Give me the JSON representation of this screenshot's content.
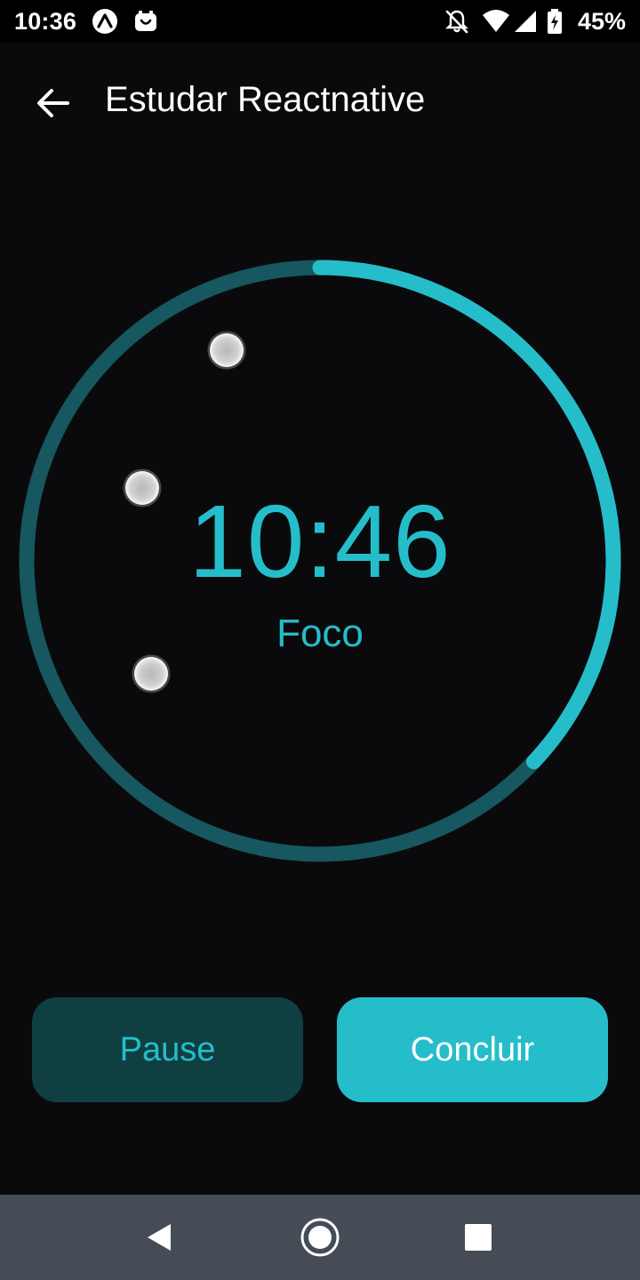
{
  "status_bar": {
    "time": "10:36",
    "icons": [
      "expo-icon",
      "app-notification-icon",
      "bell-off-icon",
      "wifi-icon",
      "signal-icon",
      "battery-charging-icon"
    ],
    "battery": "45%"
  },
  "header": {
    "back_icon": "arrow-left-icon",
    "title": "Estudar Reactnative"
  },
  "timer": {
    "time": "10:46",
    "mode": "Foco",
    "progress_fraction": 0.37,
    "colors": {
      "active": "#26bdca",
      "track": "#17575f",
      "dots": "#cfcfcf"
    },
    "orbit_dots": 3
  },
  "actions": {
    "pause_label": "Pause",
    "finish_label": "Concluir"
  },
  "nav_bar": {
    "back": "triangle-back-icon",
    "home": "circle-home-icon",
    "recents": "square-recents-icon"
  }
}
